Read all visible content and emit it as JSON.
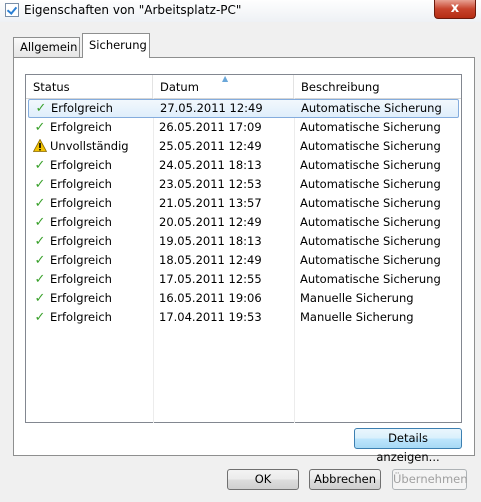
{
  "window": {
    "title": "Eigenschaften von \"Arbeitsplatz-PC\"",
    "close_label": "x"
  },
  "tabs": [
    {
      "label": "Allgemein",
      "active": false
    },
    {
      "label": "Sicherung",
      "active": true
    }
  ],
  "list": {
    "columns": [
      "Status",
      "Datum",
      "Beschreibung"
    ],
    "sorted_column": "Datum",
    "rows": [
      {
        "status": "Erfolgreich",
        "icon": "check-icon",
        "datum": "27.05.2011 12:49",
        "beschreibung": "Automatische Sicherung",
        "selected": true
      },
      {
        "status": "Erfolgreich",
        "icon": "check-icon",
        "datum": "26.05.2011 17:09",
        "beschreibung": "Automatische Sicherung"
      },
      {
        "status": "Unvollständig",
        "icon": "warning-icon",
        "datum": "25.05.2011 12:49",
        "beschreibung": "Automatische Sicherung"
      },
      {
        "status": "Erfolgreich",
        "icon": "check-icon",
        "datum": "24.05.2011 18:13",
        "beschreibung": "Automatische Sicherung"
      },
      {
        "status": "Erfolgreich",
        "icon": "check-icon",
        "datum": "23.05.2011 12:53",
        "beschreibung": "Automatische Sicherung"
      },
      {
        "status": "Erfolgreich",
        "icon": "check-icon",
        "datum": "21.05.2011 13:57",
        "beschreibung": "Automatische Sicherung"
      },
      {
        "status": "Erfolgreich",
        "icon": "check-icon",
        "datum": "20.05.2011 12:49",
        "beschreibung": "Automatische Sicherung"
      },
      {
        "status": "Erfolgreich",
        "icon": "check-icon",
        "datum": "19.05.2011 18:13",
        "beschreibung": "Automatische Sicherung"
      },
      {
        "status": "Erfolgreich",
        "icon": "check-icon",
        "datum": "18.05.2011 12:49",
        "beschreibung": "Automatische Sicherung"
      },
      {
        "status": "Erfolgreich",
        "icon": "check-icon",
        "datum": "17.05.2011 12:55",
        "beschreibung": "Automatische Sicherung"
      },
      {
        "status": "Erfolgreich",
        "icon": "check-icon",
        "datum": "16.05.2011 19:06",
        "beschreibung": "Manuelle Sicherung"
      },
      {
        "status": "Erfolgreich",
        "icon": "check-icon",
        "datum": "17.04.2011 19:53",
        "beschreibung": "Manuelle Sicherung"
      }
    ]
  },
  "buttons": {
    "details": "Details anzeigen...",
    "ok": "OK",
    "cancel": "Abbrechen",
    "apply": "Übernehmen"
  },
  "colors": {
    "success": "#3aa12c",
    "warning": "#f2c200",
    "selection": "#dfeefb"
  }
}
